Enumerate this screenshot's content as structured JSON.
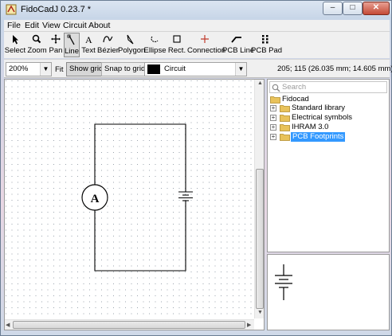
{
  "window": {
    "title": "FidoCadJ 0.23.7  *",
    "minimize_glyph": "–",
    "maximize_glyph": "□",
    "close_glyph": "✕"
  },
  "menu": [
    "File",
    "Edit",
    "View",
    "Circuit",
    "About"
  ],
  "toolbar": {
    "tools": [
      {
        "label": "Select",
        "icon": "arrow-pointer-icon"
      },
      {
        "label": "Zoom",
        "icon": "magnifier-icon"
      },
      {
        "label": "Pan",
        "icon": "pan-cross-icon"
      },
      {
        "label": "Line",
        "icon": "line-tool-icon",
        "active": true
      },
      {
        "label": "Text",
        "icon": "text-tool-icon"
      },
      {
        "label": "Bézier",
        "icon": "bezier-icon"
      },
      {
        "label": "Polygon",
        "icon": "polygon-icon"
      },
      {
        "label": "Ellipse",
        "icon": "ellipse-icon"
      },
      {
        "label": "Rect.",
        "icon": "rectangle-icon"
      },
      {
        "label": "Connection",
        "icon": "connection-cross-icon"
      },
      {
        "label": "PCB Line",
        "icon": "pcb-line-icon"
      },
      {
        "label": "PCB Pad",
        "icon": "pcb-pad-icon"
      }
    ]
  },
  "options": {
    "zoom_value": "200%",
    "fit_label": "Fit",
    "show_grid_label": "Show grid",
    "snap_to_grid_label": "Snap to grid",
    "layer_name": "Circuit",
    "layer_color": "#000000",
    "coordinates": "205; 115 (26.035 mm; 14.605 mm)"
  },
  "canvas": {
    "ammeter_label": "A",
    "grid": "on"
  },
  "library": {
    "search_placeholder": "Search",
    "root": "Fidocad",
    "items": [
      {
        "label": "Standard library",
        "selected": false
      },
      {
        "label": "Electrical symbols",
        "selected": false
      },
      {
        "label": "IHRAM 3.0",
        "selected": false
      },
      {
        "label": "PCB Footprints",
        "selected": true
      }
    ]
  },
  "colors": {
    "selection": "#3399ff",
    "folder": "#e8c25a"
  }
}
